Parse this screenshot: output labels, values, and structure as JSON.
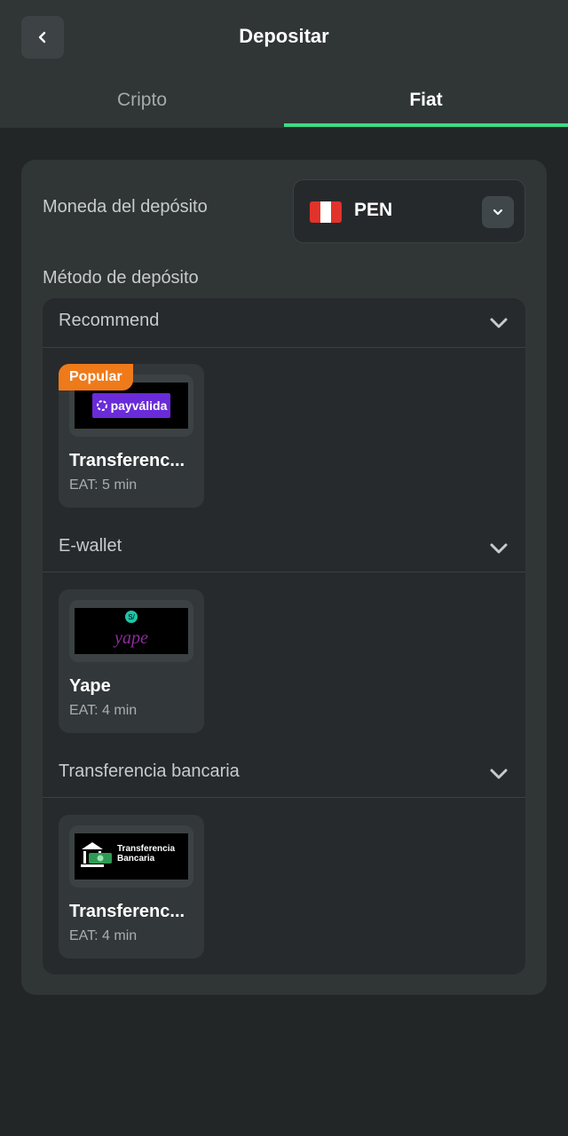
{
  "header": {
    "title": "Depositar",
    "back_icon": "chevron-left-icon"
  },
  "tabs": [
    {
      "label": "Cripto",
      "active": false
    },
    {
      "label": "Fiat",
      "active": true
    }
  ],
  "accent_color": "#3ddc84",
  "deposit_currency": {
    "label": "Moneda del depósito",
    "code": "PEN",
    "flag": "peru-flag-icon"
  },
  "deposit_method": {
    "label": "Método de depósito",
    "groups": [
      {
        "title": "Recommend",
        "methods": [
          {
            "name": "Transferencia bancaria",
            "display_name": "Transferenc...",
            "eat": "EAT: 5 min",
            "badge": "Popular",
            "logo": "payvalida-logo",
            "logo_text": "payválida"
          }
        ]
      },
      {
        "title": "E-wallet",
        "methods": [
          {
            "name": "Yape",
            "display_name": "Yape",
            "eat": "EAT: 4 min",
            "logo": "yape-logo",
            "logo_text": "yape",
            "logo_badge": "S/"
          }
        ]
      },
      {
        "title": "Transferencia bancaria",
        "methods": [
          {
            "name": "Transferencia bancaria",
            "display_name": "Transferenc...",
            "eat": "EAT: 4 min",
            "logo": "bank-transfer-logo",
            "logo_text_1": "Transferencia",
            "logo_text_2": "Bancaria"
          }
        ]
      }
    ]
  },
  "colors": {
    "popular_badge": "#ef7a1a",
    "payvalida_brand": "#6a2bd9",
    "yape_brand": "#8e2b9c"
  }
}
